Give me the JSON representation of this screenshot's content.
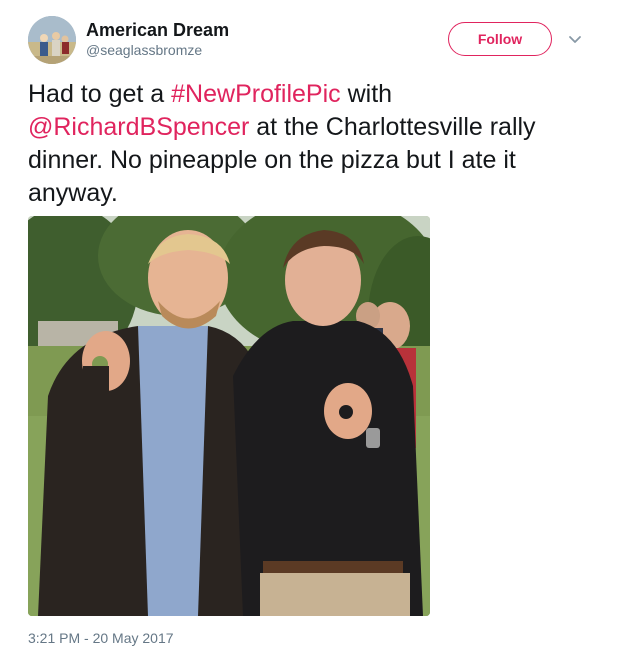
{
  "author": {
    "display_name": "American Dream",
    "handle": "@seaglassbromze"
  },
  "actions": {
    "follow_label": "Follow",
    "caret_icon": "chevron-down-icon"
  },
  "tweet": {
    "text_1": "Had to get a ",
    "hashtag": "#NewProfilePic",
    "text_2": " with ",
    "mention": "@RichardBSpencer",
    "text_3": " at the Charlottesville rally dinner. No pineapple on the pizza but I ate it anyway.",
    "timestamp": "3:21 PM - 20 May 2017"
  },
  "colors": {
    "accent": "#e0245e",
    "text": "#14171a",
    "secondary_text": "#657786"
  }
}
